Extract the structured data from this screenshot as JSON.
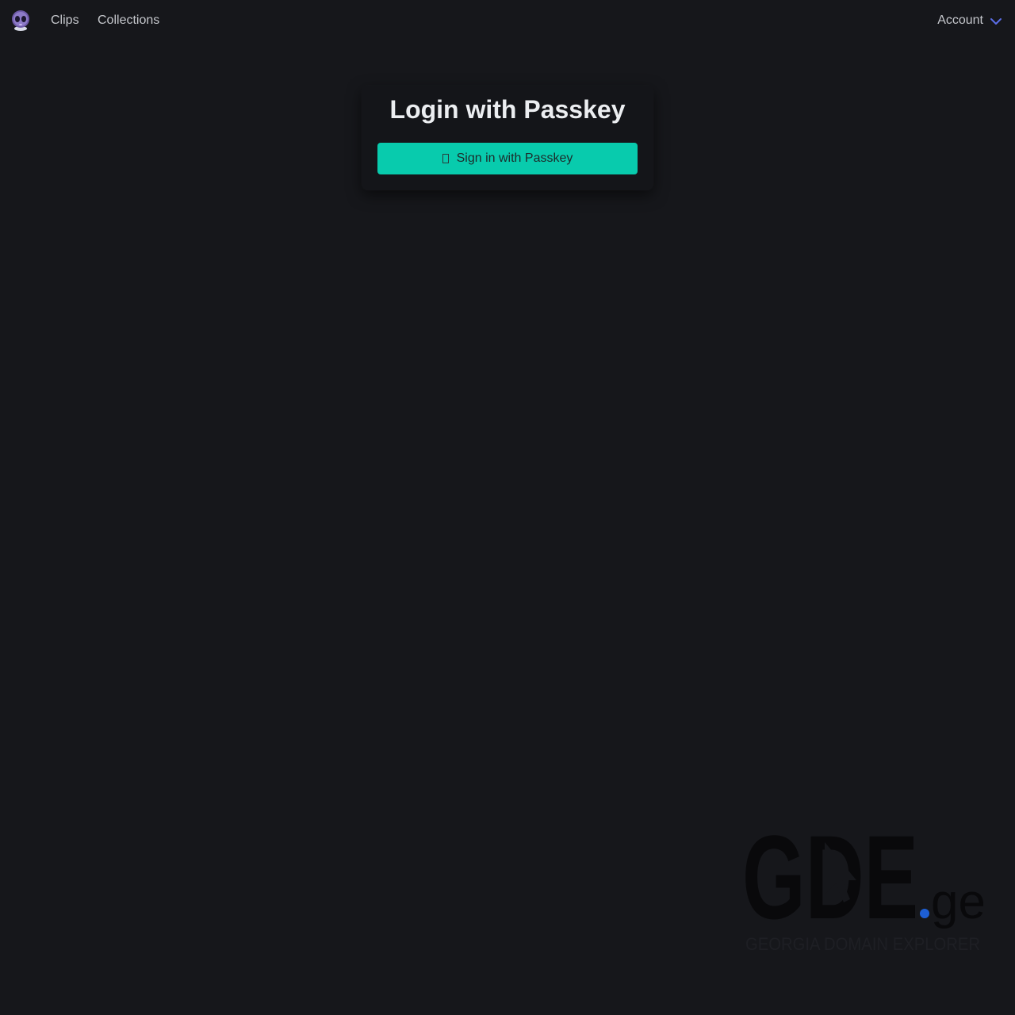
{
  "nav": {
    "logo_icon": "alien-icon",
    "links": [
      {
        "label": "Clips"
      },
      {
        "label": "Collections"
      }
    ],
    "account_label": "Account",
    "account_icon": "chevron-down-icon",
    "accent_color": "#5b6ee8"
  },
  "login": {
    "title": "Login with Passkey",
    "button_label": "Sign in with Passkey",
    "button_icon": "key-icon",
    "button_color": "#08cbad"
  },
  "watermark": {
    "logo_text": "GDE",
    "tld": ".ge",
    "tagline": "GEORGIA DOMAIN EXPLORER"
  }
}
